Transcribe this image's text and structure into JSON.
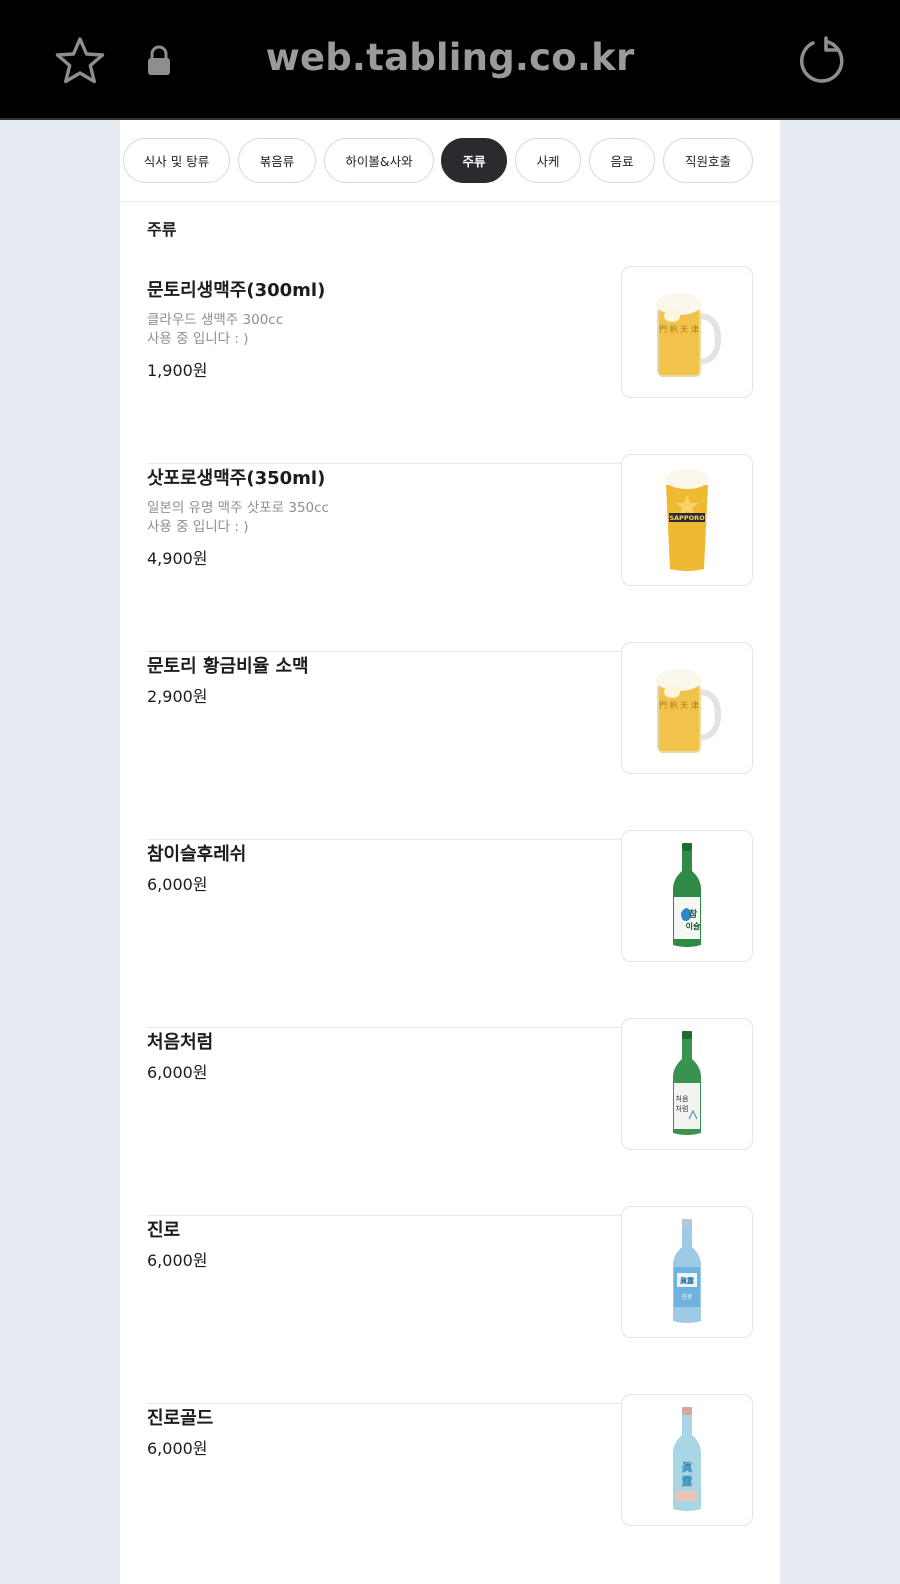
{
  "browser": {
    "url": "web.tabling.co.kr",
    "icons": [
      "star-icon",
      "lock-icon",
      "reload-icon"
    ]
  },
  "categories": [
    {
      "label": "식사 및 탕류",
      "active": false
    },
    {
      "label": "볶음류",
      "active": false
    },
    {
      "label": "하이볼&사와",
      "active": false
    },
    {
      "label": "주류",
      "active": true
    },
    {
      "label": "사케",
      "active": false
    },
    {
      "label": "음료",
      "active": false
    },
    {
      "label": "직원호출",
      "active": false
    }
  ],
  "section": {
    "title": "주류"
  },
  "items": [
    {
      "name": "문토리생맥주(300ml)",
      "desc1": "클라우드 생맥주 300cc",
      "desc2": "사용 중 입니다 : )",
      "price": "1,900원",
      "image": "beer-mug-icon"
    },
    {
      "name": "삿포로생맥주(350ml)",
      "desc1": "일본의 유명 맥주 삿포로 350cc",
      "desc2": "사용 중 입니다 : )",
      "price": "4,900원",
      "image": "sapporo-glass-icon"
    },
    {
      "name": "문토리 황금비율 소맥",
      "price": "2,900원",
      "image": "beer-mug-icon"
    },
    {
      "name": "참이슬후레쉬",
      "price": "6,000원",
      "image": "green-soju-bottle-icon"
    },
    {
      "name": "처음처럼",
      "price": "6,000원",
      "image": "green-soju-bottle-icon"
    },
    {
      "name": "진로",
      "price": "6,000원",
      "image": "blue-soju-bottle-icon"
    },
    {
      "name": "진로골드",
      "price": "6,000원",
      "image": "blue-soju-bottle-icon"
    }
  ],
  "colors": {
    "accent": "#2a2b2e",
    "page_bg": "#e6ebf2",
    "browser_bar": "#000000"
  }
}
